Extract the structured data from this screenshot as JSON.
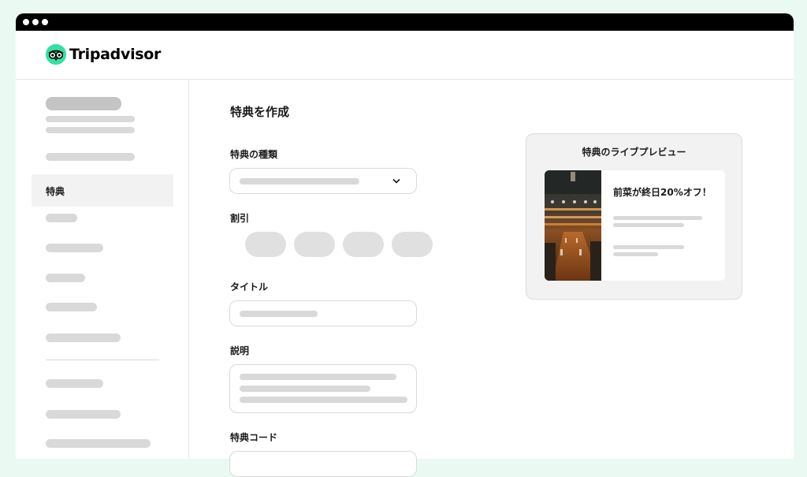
{
  "app": {
    "brand": "Tripadvisor",
    "brand_color": "#34e0a1"
  },
  "sidebar": {
    "active_item": "特典"
  },
  "main": {
    "title": "特典を作成",
    "fields": {
      "offer_type_label": "特典の種類",
      "discount_label": "割引",
      "title_label": "タイトル",
      "description_label": "説明",
      "code_label": "特典コード"
    }
  },
  "preview": {
    "heading": "特典のライブプレビュー",
    "offer_text": "前菜が終日20%オフ！"
  },
  "icons": [
    "tripadvisor-owl-icon",
    "chevron-down-icon"
  ]
}
